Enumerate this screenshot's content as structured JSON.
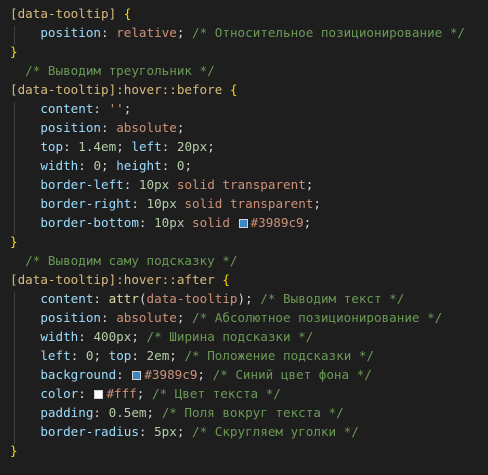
{
  "lines": [
    [
      {
        "t": "selector",
        "v": "[data-tooltip]"
      },
      {
        "t": "punct",
        "v": " "
      },
      {
        "t": "brace",
        "v": "{"
      }
    ],
    [
      {
        "t": "punct",
        "v": "    "
      },
      {
        "t": "property",
        "v": "position"
      },
      {
        "t": "punct",
        "v": ": "
      },
      {
        "t": "value",
        "v": "relative"
      },
      {
        "t": "punct",
        "v": "; "
      },
      {
        "t": "comment",
        "v": "/* Относительное позиционирование */"
      }
    ],
    [
      {
        "t": "brace",
        "v": "}"
      }
    ],
    [
      {
        "t": "punct",
        "v": "  "
      },
      {
        "t": "comment",
        "v": "/* Выводим треугольник */"
      }
    ],
    [
      {
        "t": "selector",
        "v": "[data-tooltip]"
      },
      {
        "t": "pseudo",
        "v": ":hover::before"
      },
      {
        "t": "punct",
        "v": " "
      },
      {
        "t": "brace",
        "v": "{"
      }
    ],
    [
      {
        "t": "punct",
        "v": "    "
      },
      {
        "t": "property",
        "v": "content"
      },
      {
        "t": "punct",
        "v": ": "
      },
      {
        "t": "value",
        "v": "''"
      },
      {
        "t": "punct",
        "v": ";"
      }
    ],
    [
      {
        "t": "punct",
        "v": "    "
      },
      {
        "t": "property",
        "v": "position"
      },
      {
        "t": "punct",
        "v": ": "
      },
      {
        "t": "value",
        "v": "absolute"
      },
      {
        "t": "punct",
        "v": ";"
      }
    ],
    [
      {
        "t": "punct",
        "v": "    "
      },
      {
        "t": "property",
        "v": "top"
      },
      {
        "t": "punct",
        "v": ": "
      },
      {
        "t": "number",
        "v": "1.4em"
      },
      {
        "t": "punct",
        "v": "; "
      },
      {
        "t": "property",
        "v": "left"
      },
      {
        "t": "punct",
        "v": ": "
      },
      {
        "t": "number",
        "v": "20px"
      },
      {
        "t": "punct",
        "v": ";"
      }
    ],
    [
      {
        "t": "punct",
        "v": "    "
      },
      {
        "t": "property",
        "v": "width"
      },
      {
        "t": "punct",
        "v": ": "
      },
      {
        "t": "number",
        "v": "0"
      },
      {
        "t": "punct",
        "v": "; "
      },
      {
        "t": "property",
        "v": "height"
      },
      {
        "t": "punct",
        "v": ": "
      },
      {
        "t": "number",
        "v": "0"
      },
      {
        "t": "punct",
        "v": ";"
      }
    ],
    [
      {
        "t": "punct",
        "v": "    "
      },
      {
        "t": "property",
        "v": "border-left"
      },
      {
        "t": "punct",
        "v": ": "
      },
      {
        "t": "number",
        "v": "10px"
      },
      {
        "t": "punct",
        "v": " "
      },
      {
        "t": "value",
        "v": "solid"
      },
      {
        "t": "punct",
        "v": " "
      },
      {
        "t": "value",
        "v": "transparent"
      },
      {
        "t": "punct",
        "v": ";"
      }
    ],
    [
      {
        "t": "punct",
        "v": "    "
      },
      {
        "t": "property",
        "v": "border-right"
      },
      {
        "t": "punct",
        "v": ": "
      },
      {
        "t": "number",
        "v": "10px"
      },
      {
        "t": "punct",
        "v": " "
      },
      {
        "t": "value",
        "v": "solid"
      },
      {
        "t": "punct",
        "v": " "
      },
      {
        "t": "value",
        "v": "transparent"
      },
      {
        "t": "punct",
        "v": ";"
      }
    ],
    [
      {
        "t": "punct",
        "v": "    "
      },
      {
        "t": "property",
        "v": "border-bottom"
      },
      {
        "t": "punct",
        "v": ": "
      },
      {
        "t": "number",
        "v": "10px"
      },
      {
        "t": "punct",
        "v": " "
      },
      {
        "t": "value",
        "v": "solid"
      },
      {
        "t": "punct",
        "v": " "
      },
      {
        "t": "swatch",
        "c": "#3989c9"
      },
      {
        "t": "value",
        "v": "#3989c9"
      },
      {
        "t": "punct",
        "v": ";"
      }
    ],
    [
      {
        "t": "brace",
        "v": "}"
      }
    ],
    [
      {
        "t": "punct",
        "v": "  "
      },
      {
        "t": "comment",
        "v": "/* Выводим саму подсказку */"
      }
    ],
    [
      {
        "t": "selector",
        "v": "[data-tooltip]"
      },
      {
        "t": "pseudo",
        "v": ":hover::after"
      },
      {
        "t": "punct",
        "v": " "
      },
      {
        "t": "brace",
        "v": "{"
      }
    ],
    [
      {
        "t": "punct",
        "v": "    "
      },
      {
        "t": "property",
        "v": "content"
      },
      {
        "t": "punct",
        "v": ": "
      },
      {
        "t": "func",
        "v": "attr"
      },
      {
        "t": "punct",
        "v": "("
      },
      {
        "t": "value",
        "v": "data-tooltip"
      },
      {
        "t": "punct",
        "v": "); "
      },
      {
        "t": "comment",
        "v": "/* Выводим текст */"
      }
    ],
    [
      {
        "t": "punct",
        "v": "    "
      },
      {
        "t": "property",
        "v": "position"
      },
      {
        "t": "punct",
        "v": ": "
      },
      {
        "t": "value",
        "v": "absolute"
      },
      {
        "t": "punct",
        "v": "; "
      },
      {
        "t": "comment",
        "v": "/* Абсолютное позиционирование */"
      }
    ],
    [
      {
        "t": "punct",
        "v": "    "
      },
      {
        "t": "property",
        "v": "width"
      },
      {
        "t": "punct",
        "v": ": "
      },
      {
        "t": "number",
        "v": "400px"
      },
      {
        "t": "punct",
        "v": "; "
      },
      {
        "t": "comment",
        "v": "/* Ширина подсказки */"
      }
    ],
    [
      {
        "t": "punct",
        "v": "    "
      },
      {
        "t": "property",
        "v": "left"
      },
      {
        "t": "punct",
        "v": ": "
      },
      {
        "t": "number",
        "v": "0"
      },
      {
        "t": "punct",
        "v": "; "
      },
      {
        "t": "property",
        "v": "top"
      },
      {
        "t": "punct",
        "v": ": "
      },
      {
        "t": "number",
        "v": "2em"
      },
      {
        "t": "punct",
        "v": "; "
      },
      {
        "t": "comment",
        "v": "/* Положение подсказки */"
      }
    ],
    [
      {
        "t": "punct",
        "v": "    "
      },
      {
        "t": "property",
        "v": "background"
      },
      {
        "t": "punct",
        "v": ": "
      },
      {
        "t": "swatch",
        "c": "#3989c9"
      },
      {
        "t": "value",
        "v": "#3989c9"
      },
      {
        "t": "punct",
        "v": "; "
      },
      {
        "t": "comment",
        "v": "/* Синий цвет фона */"
      }
    ],
    [
      {
        "t": "punct",
        "v": "    "
      },
      {
        "t": "property",
        "v": "color"
      },
      {
        "t": "punct",
        "v": ": "
      },
      {
        "t": "swatch",
        "c": "#ffffff"
      },
      {
        "t": "value",
        "v": "#fff"
      },
      {
        "t": "punct",
        "v": "; "
      },
      {
        "t": "comment",
        "v": "/* Цвет текста */"
      }
    ],
    [
      {
        "t": "punct",
        "v": "    "
      },
      {
        "t": "property",
        "v": "padding"
      },
      {
        "t": "punct",
        "v": ": "
      },
      {
        "t": "number",
        "v": "0.5em"
      },
      {
        "t": "punct",
        "v": "; "
      },
      {
        "t": "comment",
        "v": "/* Поля вокруг текста */"
      }
    ],
    [
      {
        "t": "punct",
        "v": "    "
      },
      {
        "t": "property",
        "v": "border-radius"
      },
      {
        "t": "punct",
        "v": ": "
      },
      {
        "t": "number",
        "v": "5px"
      },
      {
        "t": "punct",
        "v": "; "
      },
      {
        "t": "comment",
        "v": "/* Скругляем уголки */"
      }
    ],
    [
      {
        "t": "brace",
        "v": "}"
      }
    ]
  ],
  "theme": {
    "background": "#1e1e1e",
    "selector": "#d7ba7d",
    "brace": "#ffd700",
    "property": "#9cdcfe",
    "value": "#ce9178",
    "number": "#b5cea8",
    "comment": "#6a9955"
  }
}
